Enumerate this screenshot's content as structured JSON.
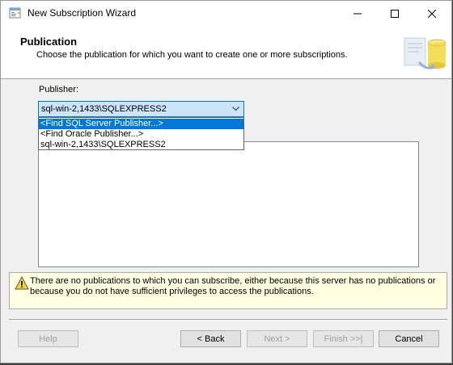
{
  "window": {
    "title": "New Subscription Wizard"
  },
  "header": {
    "title": "Publication",
    "subtitle": "Choose the publication for which you want to create one or more subscriptions."
  },
  "publisher": {
    "label": "Publisher:",
    "selected": "sql-win-2,1433\\SQLEXPRESS2",
    "options": [
      "<Find SQL Server Publisher...>",
      "<Find Oracle Publisher...>",
      "sql-win-2,1433\\SQLEXPRESS2"
    ],
    "highlighted_option_index": 0
  },
  "message": {
    "text": "There are no publications to which you can subscribe, either because this server has no publications or because you do not have sufficient privileges to access the publications."
  },
  "buttons": {
    "help": "Help",
    "back": "< Back",
    "next": "Next >",
    "finish": "Finish >>|",
    "cancel": "Cancel"
  },
  "colors": {
    "selection": "#0078d7",
    "combo_focus": "#cce4f7",
    "info_background": "#ffffe1"
  }
}
